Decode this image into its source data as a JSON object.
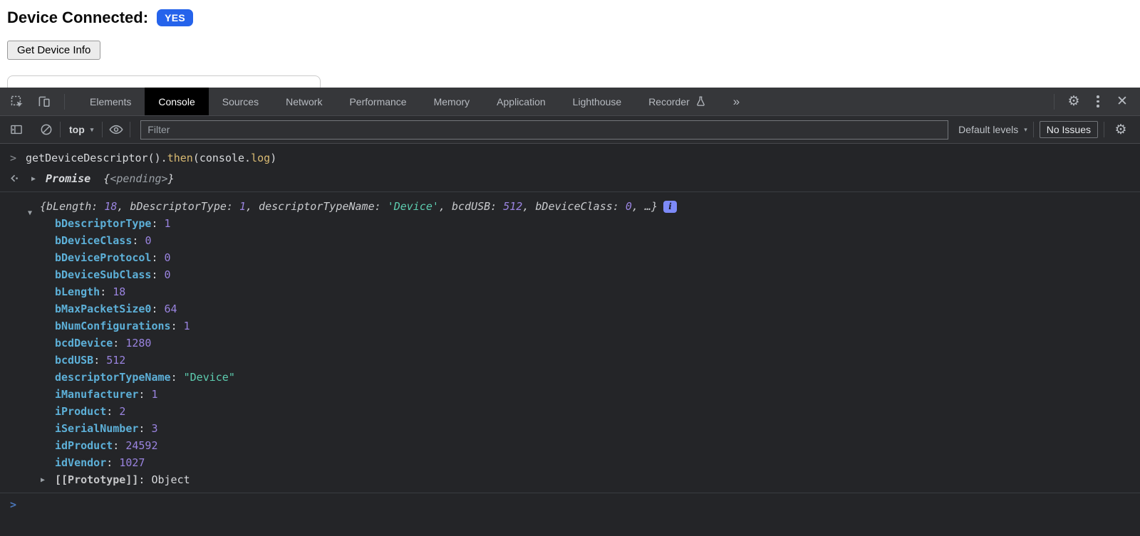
{
  "page": {
    "device_connected_label": "Device Connected:",
    "device_connected_value": "YES",
    "get_device_info_button": "Get Device Info"
  },
  "devtools": {
    "tabs": [
      {
        "label": "Elements"
      },
      {
        "label": "Console"
      },
      {
        "label": "Sources"
      },
      {
        "label": "Network"
      },
      {
        "label": "Performance"
      },
      {
        "label": "Memory"
      },
      {
        "label": "Application"
      },
      {
        "label": "Lighthouse"
      },
      {
        "label": "Recorder",
        "icon": "flask"
      }
    ],
    "selected_tab": "Console"
  },
  "toolbar": {
    "context_selector": "top",
    "filter_placeholder": "Filter",
    "levels_label": "Default levels",
    "issues_label": "No Issues"
  },
  "console": {
    "prompt_char": ">",
    "command_tokens": [
      {
        "t": "getDeviceDescriptor().",
        "c": "plain"
      },
      {
        "t": "then",
        "c": "prop"
      },
      {
        "t": "(console.",
        "c": "plain"
      },
      {
        "t": "log",
        "c": "prop"
      },
      {
        "t": ")",
        "c": "plain"
      }
    ],
    "result_name": "Promise",
    "result_tokens": [
      {
        "t": "{",
        "c": "plain"
      },
      {
        "t": "<pending>",
        "c": "dim"
      },
      {
        "t": "}",
        "c": "plain"
      }
    ],
    "log_object": {
      "preview_tokens": [
        {
          "t": "{bLength: ",
          "c": "preview"
        },
        {
          "t": "18",
          "c": "num"
        },
        {
          "t": ", bDescriptorType: ",
          "c": "preview"
        },
        {
          "t": "1",
          "c": "num"
        },
        {
          "t": ", descriptorTypeName: ",
          "c": "preview"
        },
        {
          "t": "'Device'",
          "c": "str"
        },
        {
          "t": ", bcdUSB: ",
          "c": "preview"
        },
        {
          "t": "512",
          "c": "num"
        },
        {
          "t": ", bDeviceClass: ",
          "c": "preview"
        },
        {
          "t": "0",
          "c": "num"
        },
        {
          "t": ", …}",
          "c": "preview"
        }
      ],
      "properties": [
        {
          "key": "bDescriptorType",
          "value": "1",
          "type": "number"
        },
        {
          "key": "bDeviceClass",
          "value": "0",
          "type": "number"
        },
        {
          "key": "bDeviceProtocol",
          "value": "0",
          "type": "number"
        },
        {
          "key": "bDeviceSubClass",
          "value": "0",
          "type": "number"
        },
        {
          "key": "bLength",
          "value": "18",
          "type": "number"
        },
        {
          "key": "bMaxPacketSize0",
          "value": "64",
          "type": "number"
        },
        {
          "key": "bNumConfigurations",
          "value": "1",
          "type": "number"
        },
        {
          "key": "bcdDevice",
          "value": "1280",
          "type": "number"
        },
        {
          "key": "bcdUSB",
          "value": "512",
          "type": "number"
        },
        {
          "key": "descriptorTypeName",
          "value": "\"Device\"",
          "type": "string"
        },
        {
          "key": "iManufacturer",
          "value": "1",
          "type": "number"
        },
        {
          "key": "iProduct",
          "value": "2",
          "type": "number"
        },
        {
          "key": "iSerialNumber",
          "value": "3",
          "type": "number"
        },
        {
          "key": "idProduct",
          "value": "24592",
          "type": "number"
        },
        {
          "key": "idVendor",
          "value": "1027",
          "type": "number"
        }
      ],
      "prototype_key": "[[Prototype]]",
      "prototype_value": "Object"
    }
  },
  "icons": {
    "settings": "⚙",
    "close": "✕",
    "more_tabs": "»",
    "caret_down": "▾",
    "expanded": "▼",
    "collapsed": "▶"
  },
  "colors": {
    "badge_blue": "#2563eb",
    "key_cyan": "#5db0d8",
    "num_purple": "#9a84e0",
    "str_teal": "#5dcdb0",
    "prop_yellow": "#d9ba72",
    "prompt_blue": "#4a76b8",
    "info_badge": "#7d8af8"
  }
}
